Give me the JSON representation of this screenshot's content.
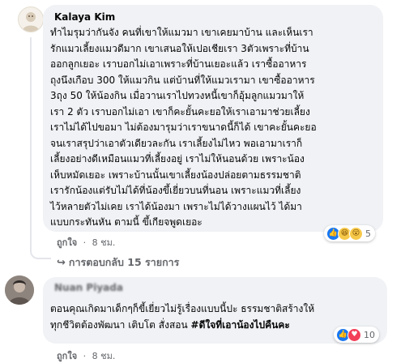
{
  "comment1": {
    "author": "Kalaya Kim",
    "lines": [
      "ทำไมรุมว่ากันจัง คนที่เขาให้แมวมา เขาเคยมาบ้าน และเห็นเรา",
      "รักแมวเลี้ยงแมวดีมาก เขาเสนอให้เปอเชียเรา 3ตัวเพราะที่บ้าน",
      "ออกลูกเยอะ เราบอกไม่เอาเพราะที่บ้านเยอะแล้ว เราซื้ออาหาร",
      "ถุงนึงเกือบ 300 ให้แมวกิน แต่บ้านที่ให้แมวเรามา เขาซื้ออาหาร",
      "3ถุง 50 ให้น้องกิน เมื่อวานเราไปทวงหนี้เขาก็อุ้มลูกแมวมาให้",
      "เรา 2 ตัว เราบอกไม่เอา เขาก็คะยั้นคะยอให้เราเอามาช่วยเลี้ยง",
      "เราไม่ได้ไปขอมา ไม่ต้องมารุมว่าเราขนาดนี้ก็ได้ เขาคะยั้นคะยอ",
      "จนเราสรุปว่าเอาตัวเดียวละกัน เราเลี้ยงไม่ไหว พอเอามาเราก็",
      "เลี้ยงอย่างดีเหมือนแมวที่เลี้ยงอยู่ เราไม่ให้นอนด้วย เพราะน้อง",
      "เห็บหมัดเยอะ เพราะบ้านนั้นเขาเลี้ยงน้องปล่อยตามธรรมชาติ",
      "เรารักน้องแต่รับไม่ได้ที่น้องขึ้เยี่ยวบนที่นอน เพราะแมวที่เลี้ยง",
      "ไว้หลายตัวไม่เคย เราได้น้องมา เพราะไม่ได้วางแผนไว้ ได้มา",
      "แบบกระทันหัน ตามนี้ ขึ้เกียจพูดเยอะ"
    ],
    "like_label": "ถูกใจ",
    "time": "8 ชม.",
    "reaction_count": "5"
  },
  "replies_link": "การตอบกลับ 15 รายการ",
  "comment2": {
    "author": "Nuan Piyada",
    "lines": [
      "ตอนคุณเกิดมาเด็กๆก็ขี้เยี่ยวไม่รู้เรื่องแบบนี้ปะ ธรรมชาติสร้างให้",
      "ทุกชีวิตต้องพัฒนา เติบโต สั่งสอน "
    ],
    "hashtag": "#ดีใจที่เอาน้องไปคืนคะ",
    "like_label": "ถูกใจ",
    "time": "8 ชม.",
    "reaction_count": "10"
  },
  "separator": "·",
  "icons": [
    "user-avatar-icon",
    "like-reaction-icon",
    "haha-reaction-icon",
    "wow-reaction-icon",
    "love-reaction-icon",
    "reply-arrow-icon"
  ],
  "colors": {
    "bubble": "#f0f2f5",
    "like": "#1877f2",
    "love": "#f33e58",
    "meta": "#65676b"
  }
}
